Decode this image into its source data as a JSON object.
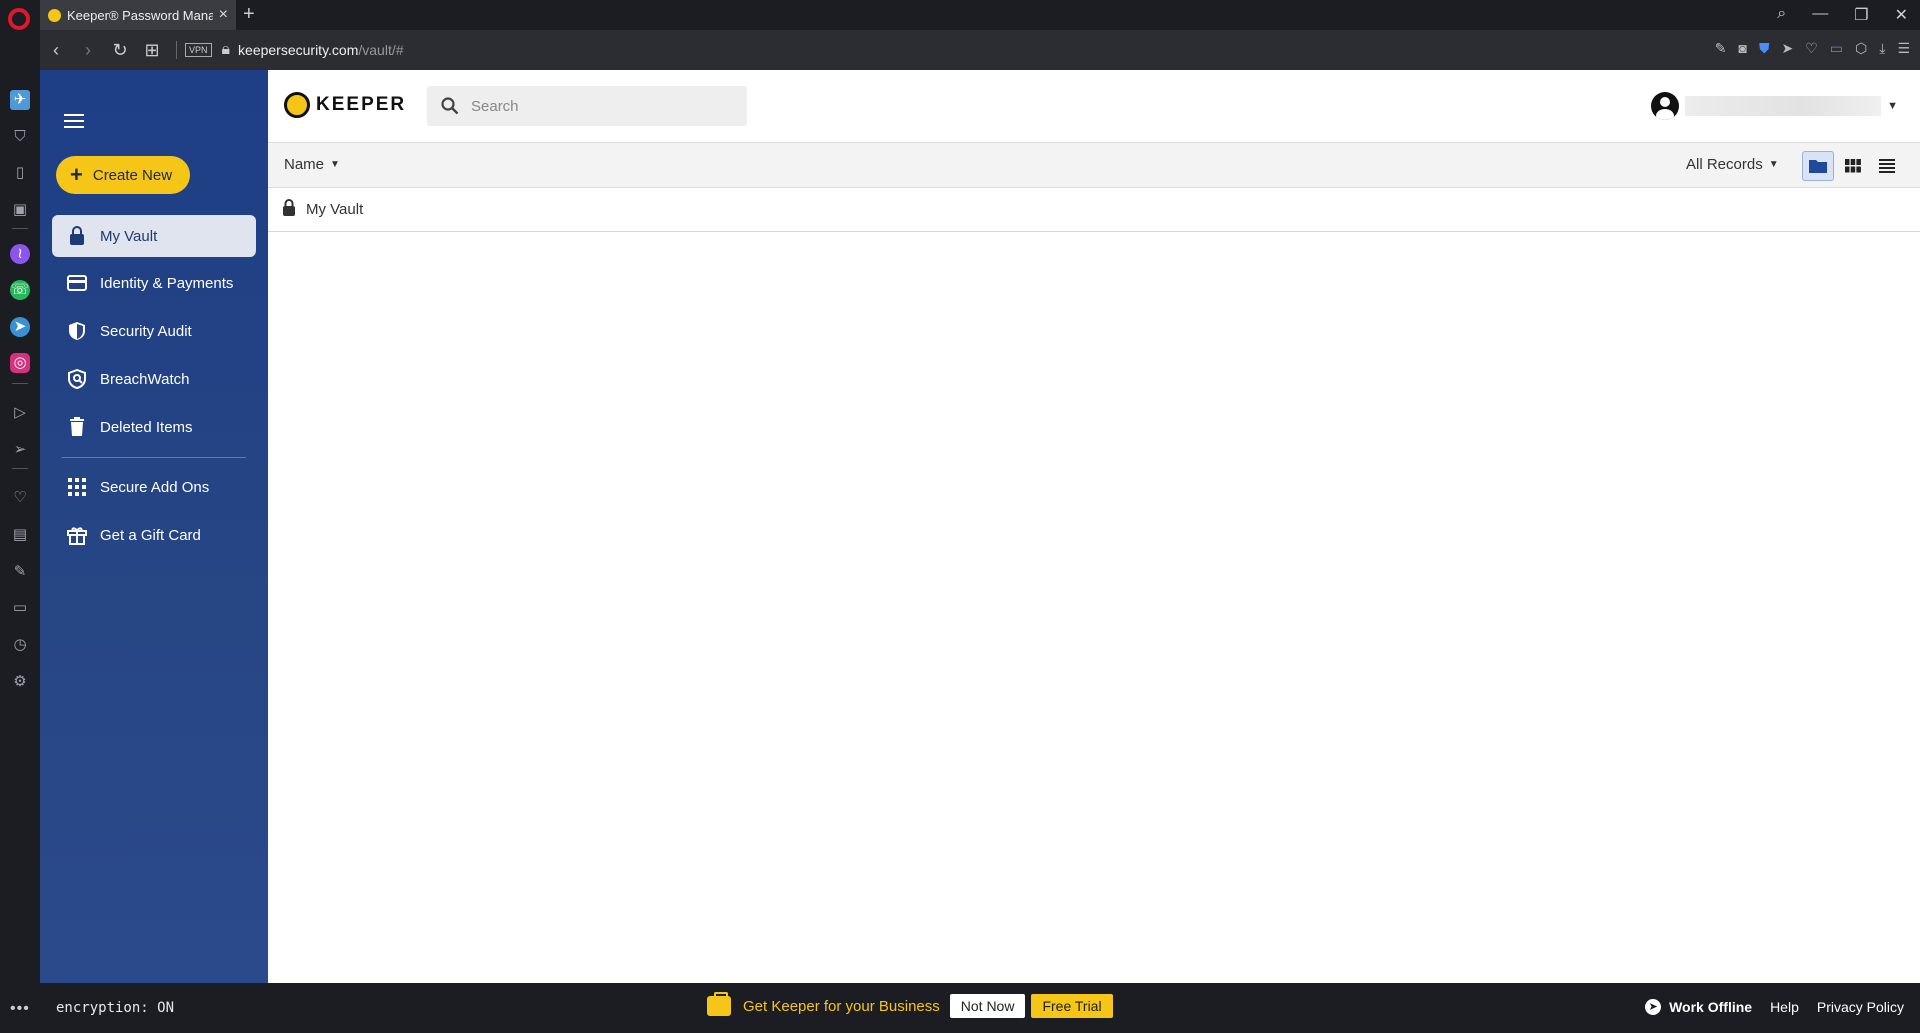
{
  "browser": {
    "tab_title": "Keeper® Password Manag",
    "url_host": "keepersecurity.com",
    "url_path": "/vault/#",
    "vpn_label": "VPN"
  },
  "sidebar": {
    "create_new_label": "Create New",
    "items": [
      {
        "label": "My Vault",
        "icon": "lock-icon",
        "active": true
      },
      {
        "label": "Identity & Payments",
        "icon": "credit-card-icon"
      },
      {
        "label": "Security Audit",
        "icon": "shield-icon"
      },
      {
        "label": "BreachWatch",
        "icon": "breachwatch-icon"
      },
      {
        "label": "Deleted Items",
        "icon": "trash-icon"
      },
      {
        "label": "Secure Add Ons",
        "icon": "grid-icon"
      },
      {
        "label": "Get a Gift Card",
        "icon": "gift-icon"
      }
    ]
  },
  "header": {
    "logo_text": "KEEPER",
    "search_placeholder": "Search"
  },
  "toolbar": {
    "sort_label": "Name",
    "filter_label": "All Records",
    "views": [
      "folder-view",
      "grid-view",
      "list-view"
    ],
    "active_view": "folder-view"
  },
  "breadcrumb": {
    "label": "My Vault"
  },
  "footer": {
    "encryption_status": "encryption: ON",
    "promo_text": "Get Keeper for your Business",
    "not_now_label": "Not Now",
    "free_trial_label": "Free Trial",
    "work_offline_label": "Work Offline",
    "help_label": "Help",
    "privacy_label": "Privacy Policy"
  },
  "colors": {
    "accent_yellow": "#f5c518",
    "sidebar_blue": "#1e3e86",
    "active_item_bg": "#dfe4ee"
  }
}
